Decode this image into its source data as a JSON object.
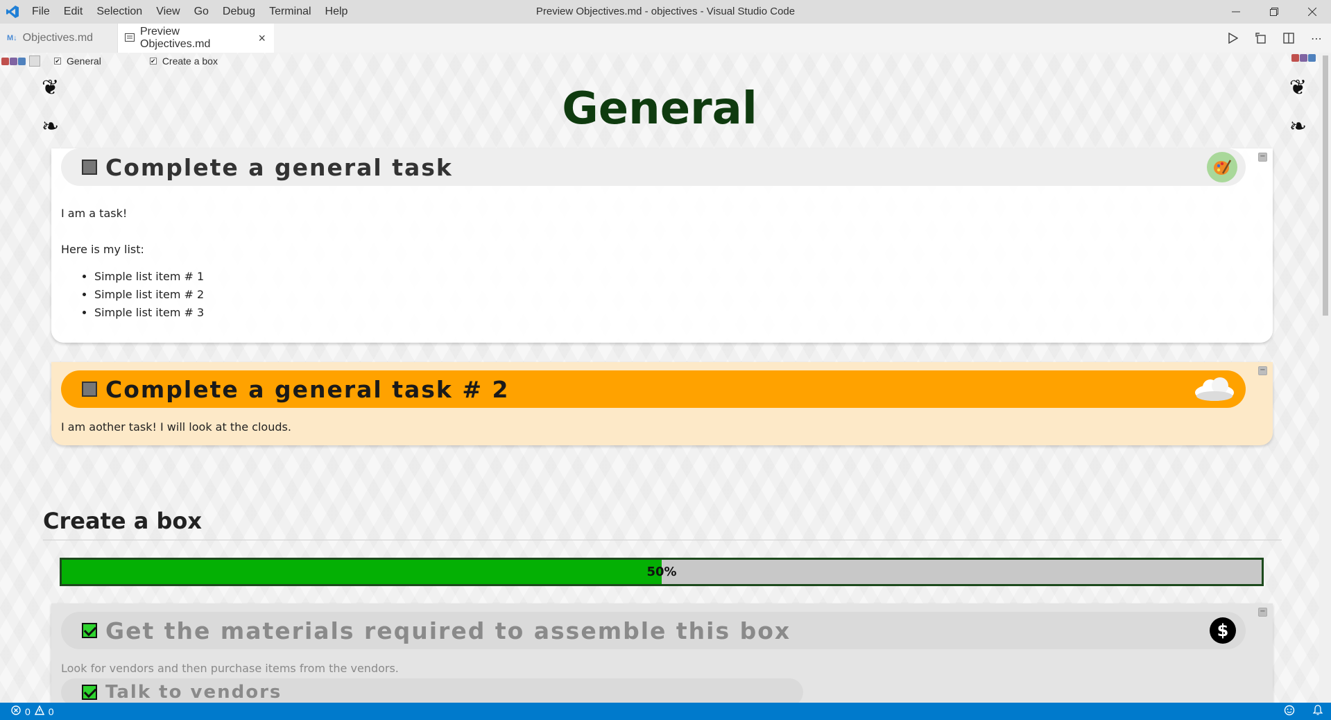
{
  "app": {
    "window_title": "Preview Objectives.md - objectives - Visual Studio Code",
    "brand_color": "#007acc"
  },
  "menu": [
    "File",
    "Edit",
    "Selection",
    "View",
    "Go",
    "Debug",
    "Terminal",
    "Help"
  ],
  "tabs": [
    {
      "label": "Objectives.md",
      "icon": "markdown-icon",
      "active": false
    },
    {
      "label": "Preview Objectives.md",
      "icon": "preview-icon",
      "active": true
    }
  ],
  "tab_actions": [
    "run-icon",
    "open-source-icon",
    "split-editor-icon",
    "more-icon"
  ],
  "checkbar": {
    "items": [
      {
        "label": "General",
        "checked": true
      },
      {
        "label": "Create a box",
        "checked": true
      }
    ]
  },
  "page": {
    "title": "General"
  },
  "tasks": [
    {
      "title": "Complete a general task",
      "done": false,
      "icon": "palette-icon",
      "text1": "I am a task!",
      "text2": "Here is my list:",
      "list": [
        "Simple list item # 1",
        "Simple list item # 2",
        "Simple list item # 3"
      ]
    },
    {
      "title": "Complete a general task # 2",
      "done": false,
      "icon": "cloud-icon",
      "color": "#ffa200",
      "text1": "I am aother task! I will look at the clouds."
    }
  ],
  "section": {
    "title": "Create a box",
    "progress": 0.5,
    "progress_label": "50%",
    "tasks": [
      {
        "title": "Get the materials required to assemble this box",
        "done": true,
        "icon": "dollar-icon",
        "text1": "Look for vendors and then purchase items from the vendors."
      },
      {
        "title": "Talk to vendors",
        "done": true
      }
    ]
  },
  "status": {
    "errors": "0",
    "warnings": "0"
  }
}
